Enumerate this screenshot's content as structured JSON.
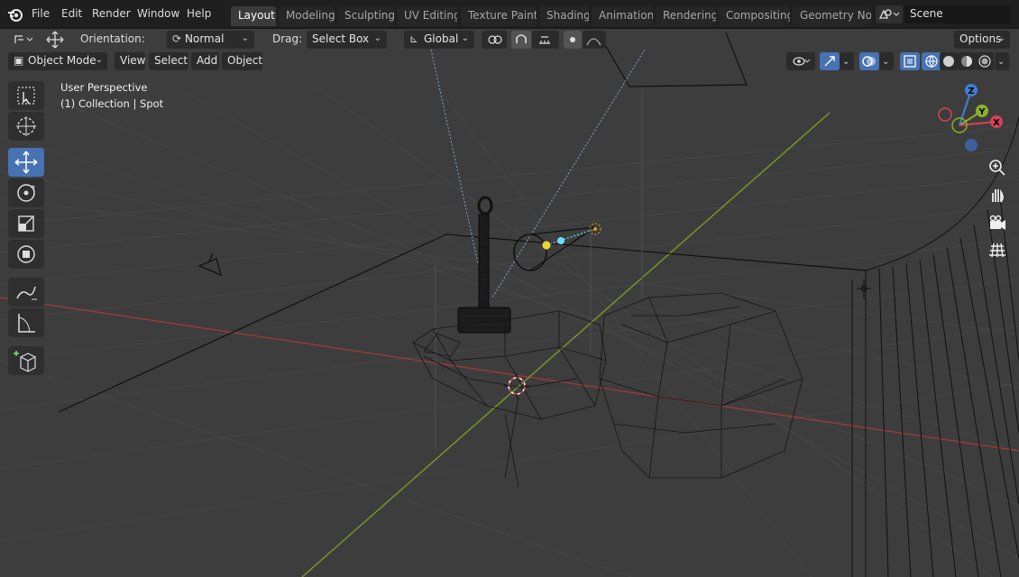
{
  "menu": {
    "file": "File",
    "edit": "Edit",
    "render": "Render",
    "window": "Window",
    "help": "Help"
  },
  "workspaces": [
    "Layout",
    "Modeling",
    "Sculpting",
    "UV Editing",
    "Texture Paint",
    "Shading",
    "Animation",
    "Rendering",
    "Compositing",
    "Geometry Nod"
  ],
  "scene": {
    "name": "Scene"
  },
  "tool_header": {
    "orientation_label": "Orientation:",
    "orientation_value": "Normal",
    "drag_label": "Drag:",
    "drag_value": "Select Box",
    "transform_space": "Global",
    "options": "Options"
  },
  "view_header": {
    "mode": "Object Mode",
    "view": "View",
    "select": "Select",
    "add": "Add",
    "object": "Object"
  },
  "viewport_info": {
    "perspective": "User Perspective",
    "collection": "(1) Collection | Spot"
  },
  "gizmo": {
    "z": "Z",
    "y": "Y",
    "x": "X"
  },
  "colors": {
    "accent": "#4772b3",
    "axis_x": "#9c3a3a",
    "axis_y": "#7a9a2a",
    "grid": "#474747"
  }
}
